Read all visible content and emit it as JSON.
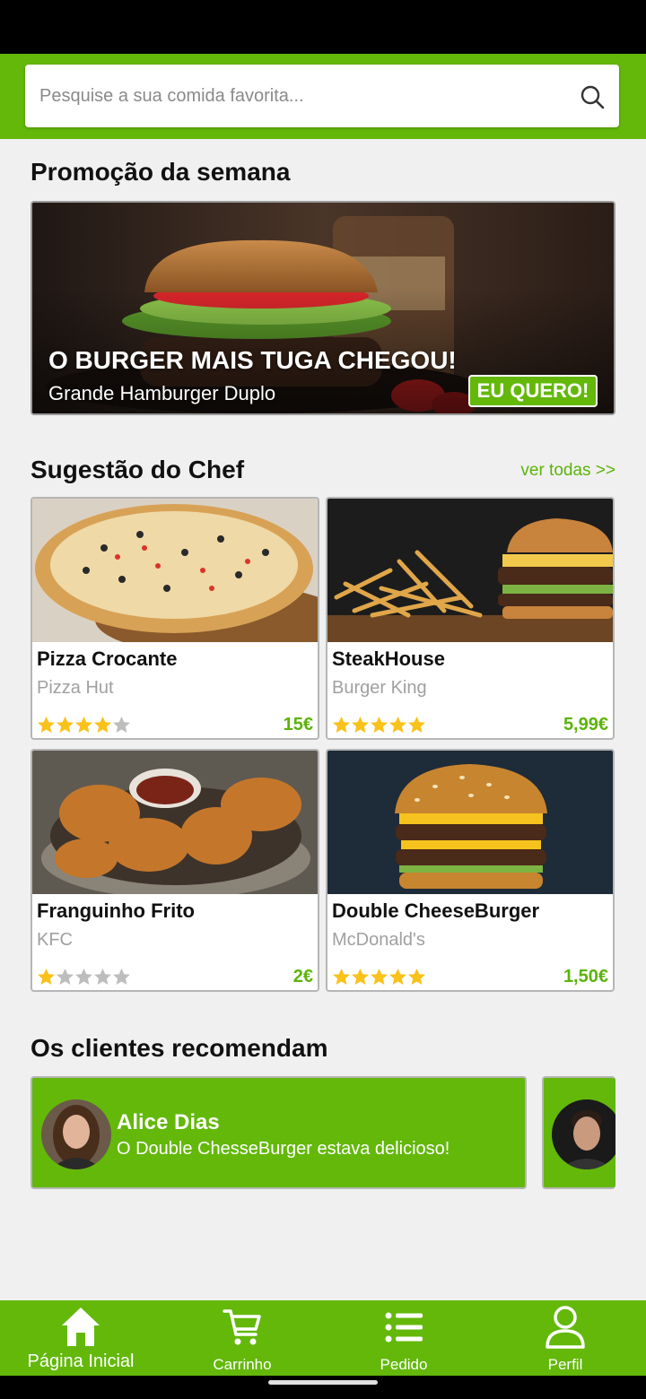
{
  "search": {
    "placeholder": "Pesquise a sua comida favorita...",
    "icon": "search-icon"
  },
  "promo": {
    "section_title": "Promoção da semana",
    "title": "O BURGER MAIS TUGA CHEGOU!",
    "subtitle": "Grande Hamburger Duplo",
    "cta": "EU QUERO!"
  },
  "chef": {
    "section_title": "Sugestão do Chef",
    "see_all": "ver todas >>",
    "items": [
      {
        "name": "Pizza Crocante",
        "store": "Pizza Hut",
        "rating": 4,
        "max_rating": 5,
        "price": "15€"
      },
      {
        "name": "SteakHouse",
        "store": "Burger King",
        "rating": 5,
        "max_rating": 5,
        "price": "5,99€"
      },
      {
        "name": "Franguinho Frito",
        "store": "KFC",
        "rating": 1,
        "max_rating": 5,
        "price": "2€"
      },
      {
        "name": "Double CheeseBurger",
        "store": "McDonald's",
        "rating": 5,
        "max_rating": 5,
        "price": "1,50€"
      }
    ]
  },
  "reviews": {
    "section_title": "Os clientes recomendam",
    "items": [
      {
        "name": "Alice Dias",
        "text": "O Double ChesseBurger estava delicioso!"
      }
    ]
  },
  "nav": {
    "items": [
      {
        "label": "Página Inicial",
        "icon": "home-icon",
        "active": true
      },
      {
        "label": "Carrinho",
        "icon": "cart-icon",
        "active": false
      },
      {
        "label": "Pedido",
        "icon": "list-icon",
        "active": false
      },
      {
        "label": "Perfil",
        "icon": "user-icon",
        "active": false
      }
    ]
  },
  "colors": {
    "brand": "#63b80a",
    "price": "#5cb30a",
    "star": "#f9c21a",
    "star_empty": "#bdbdbd"
  }
}
